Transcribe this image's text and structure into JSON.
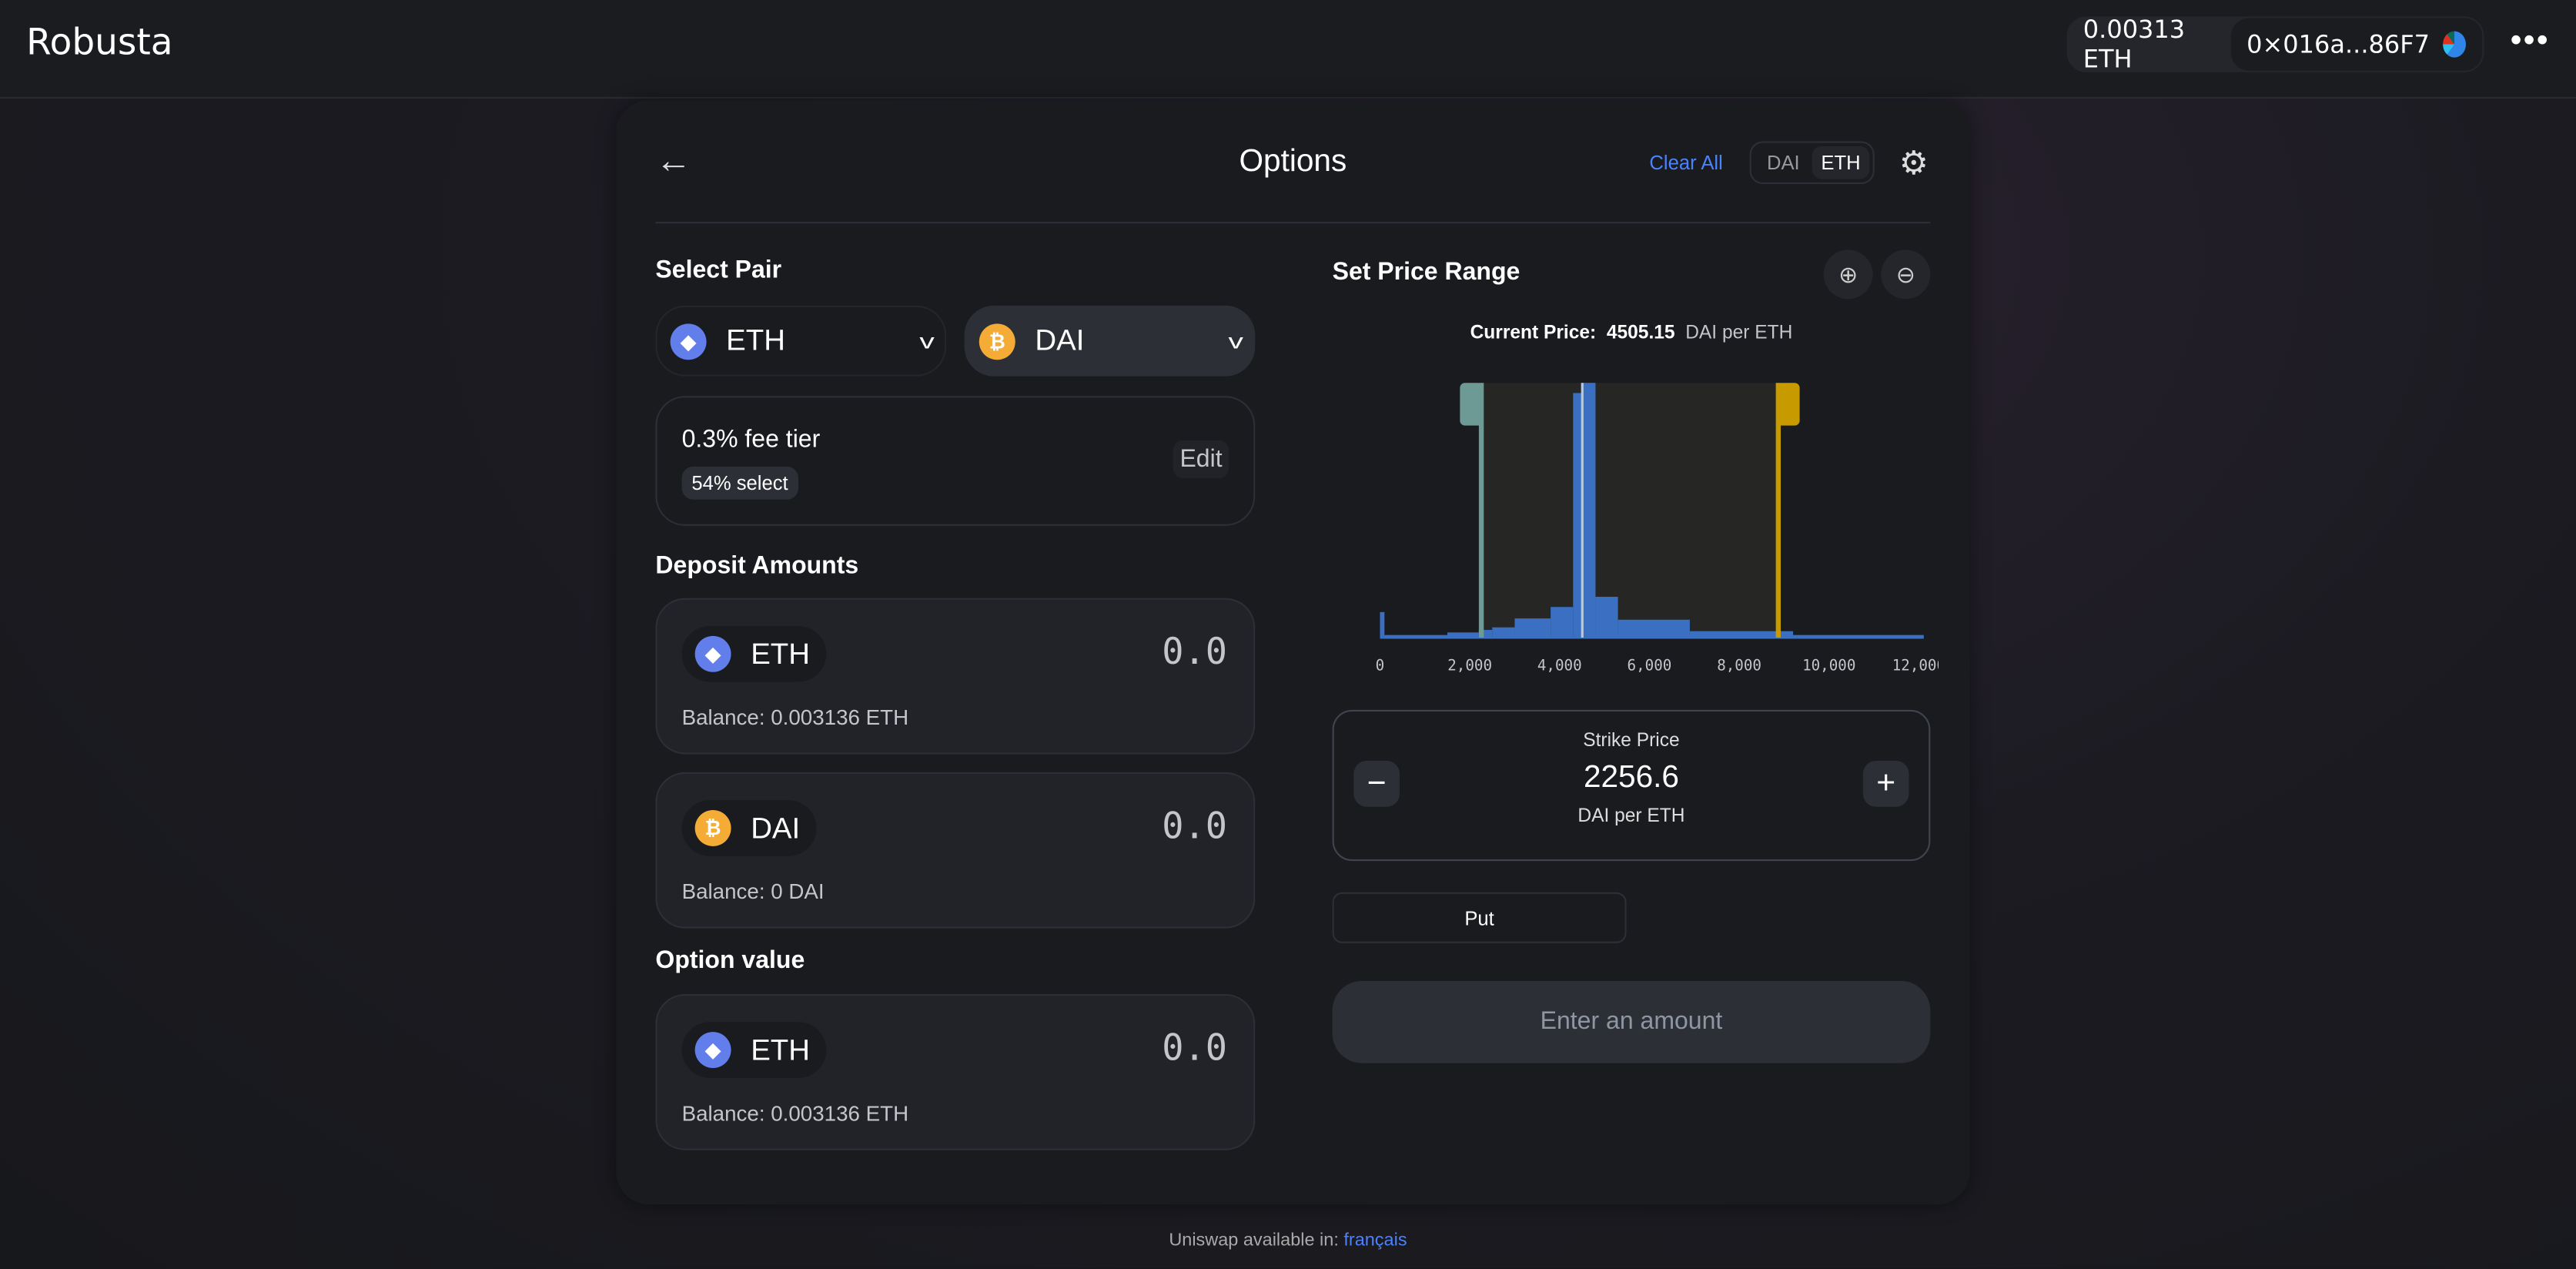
{
  "app": {
    "title": "Robusta"
  },
  "wallet": {
    "balance": "0.00313 ETH",
    "address": "0×016a...86F7",
    "more_label": "•••"
  },
  "header": {
    "title": "Options",
    "clear_all": "Clear All",
    "toggle": [
      "DAI",
      "ETH"
    ],
    "toggle_selected": "ETH",
    "back_icon": "arrow-left-icon",
    "settings_icon": "gear-icon"
  },
  "select_pair": {
    "heading": "Select Pair",
    "token_a": "ETH",
    "token_b": "DAI"
  },
  "fee": {
    "tier": "0.3% fee tier",
    "badge": "54% select",
    "edit": "Edit"
  },
  "deposit": {
    "heading": "Deposit Amounts",
    "items": [
      {
        "token": "ETH",
        "amount": "0.0",
        "balance": "Balance: 0.003136 ETH"
      },
      {
        "token": "DAI",
        "amount": "0.0",
        "balance": "Balance: 0 DAI"
      }
    ]
  },
  "option_value": {
    "heading": "Option value",
    "token": "ETH",
    "amount": "0.0",
    "balance": "Balance: 0.003136 ETH"
  },
  "price_range": {
    "heading": "Set Price Range",
    "current_price_label": "Current Price:",
    "current_price": "4505.15",
    "current_price_unit": "DAI per ETH"
  },
  "strike": {
    "label": "Strike Price",
    "value": "2256.6",
    "unit": "DAI per ETH",
    "minus": "−",
    "plus": "+"
  },
  "put_label": "Put",
  "submit_label": "Enter an amount",
  "footer": {
    "text": "Uniswap available in: ",
    "link": "français"
  },
  "colors": {
    "accent": "#4c82fb",
    "liquidity": "#3a6fc1",
    "lower_handle": "#6d9a95",
    "upper_handle": "#c79a00"
  },
  "chart_data": {
    "type": "area",
    "xlim": [
      0,
      12000
    ],
    "ticks": [
      "0",
      "2,000",
      "4,000",
      "6,000",
      "8,000",
      "10,000",
      "12,000"
    ],
    "tick_values": [
      0,
      2000,
      4000,
      6000,
      8000,
      10000,
      12000
    ],
    "bins": [
      [
        0,
        100,
        10
      ],
      [
        100,
        1500,
        1
      ],
      [
        1500,
        2200,
        2
      ],
      [
        2200,
        2500,
        3
      ],
      [
        2500,
        3000,
        4
      ],
      [
        3000,
        3800,
        7.5
      ],
      [
        3800,
        4300,
        12
      ],
      [
        4300,
        4500,
        96
      ],
      [
        4500,
        4800,
        100
      ],
      [
        4800,
        5300,
        16
      ],
      [
        5300,
        6900,
        7
      ],
      [
        6900,
        9200,
        2.5
      ],
      [
        9200,
        12500,
        1
      ]
    ],
    "current_price": 4505.15,
    "range_lower": 2256.6,
    "range_upper": 8870
  }
}
